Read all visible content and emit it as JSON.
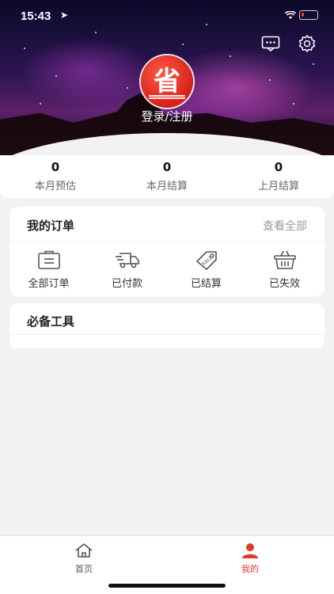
{
  "status_bar": {
    "time": "15:43"
  },
  "header": {
    "avatar_char": "省",
    "login_label": "登录/注册"
  },
  "stats": [
    {
      "value": "0",
      "label": "本月预估"
    },
    {
      "value": "0",
      "label": "本月结算"
    },
    {
      "value": "0",
      "label": "上月结算"
    }
  ],
  "orders": {
    "title": "我的订单",
    "view_all": "查看全部",
    "items": [
      {
        "label": "全部订单",
        "icon": "all-orders-icon"
      },
      {
        "label": "已付款",
        "icon": "truck-icon"
      },
      {
        "label": "已结算",
        "icon": "sale-tag-icon"
      },
      {
        "label": "已失效",
        "icon": "basket-icon"
      }
    ]
  },
  "tools": {
    "title": "必备工具"
  },
  "tabbar": {
    "home_label": "首页",
    "mine_label": "我的"
  },
  "colors": {
    "accent": "#e03a2a",
    "icon_gray": "#555555"
  }
}
